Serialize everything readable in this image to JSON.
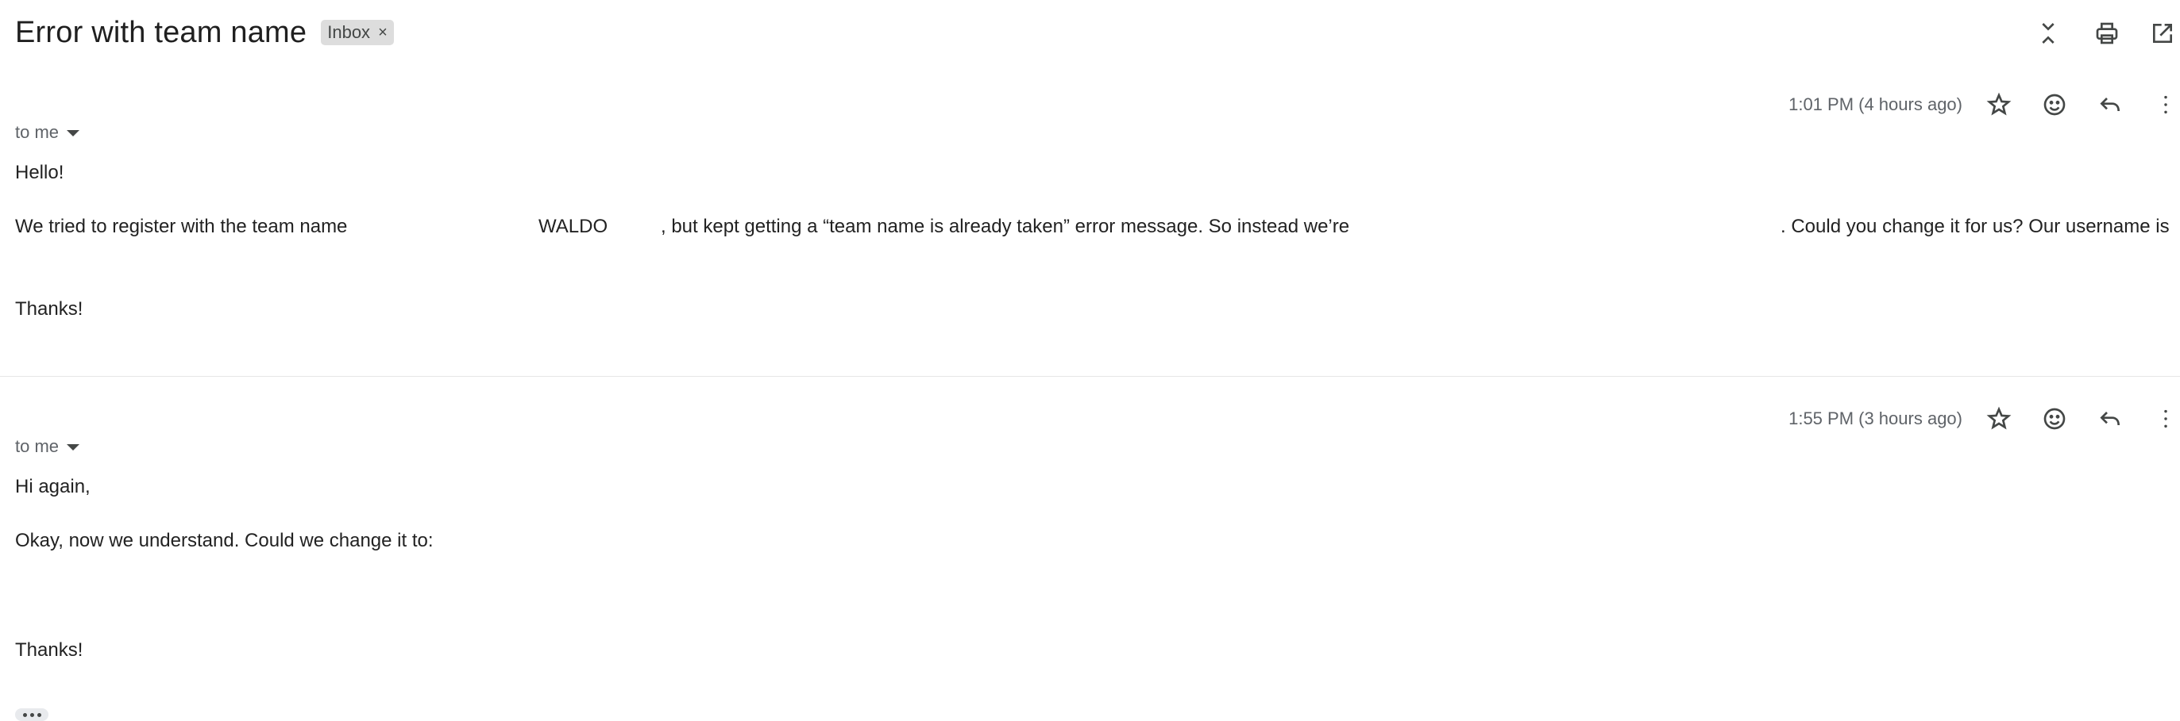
{
  "thread": {
    "subject": "Error with team name",
    "label": "Inbox",
    "label_remove": "×"
  },
  "toolbar": {
    "icons": [
      "collapse-all-icon",
      "print-icon",
      "open-in-new-window-icon"
    ]
  },
  "messages": [
    {
      "timestamp": "1:01 PM (4 hours ago)",
      "recipient": "to me",
      "greeting": "Hello!",
      "line_a": "We tried to register with the team name",
      "line_b": "WALDO",
      "line_c": ", but kept getting a “team name is already taken” error message. So instead we’re",
      "line_d": ". Could you change it for us? Our username is",
      "closing": "Thanks!"
    },
    {
      "timestamp": "1:55 PM (3 hours ago)",
      "recipient": "to me",
      "greeting": "Hi again,",
      "line_a": "Okay, now we understand. Could we change it to:",
      "closing": "Thanks!"
    }
  ],
  "message_actions": {
    "icons": [
      "star-icon",
      "emoji-reaction-icon",
      "reply-icon",
      "more-vert-icon"
    ]
  },
  "colors": {
    "text": "#222222",
    "muted": "#5f6368",
    "chip_bg": "#dddddd",
    "divider": "#e6e6e6"
  }
}
